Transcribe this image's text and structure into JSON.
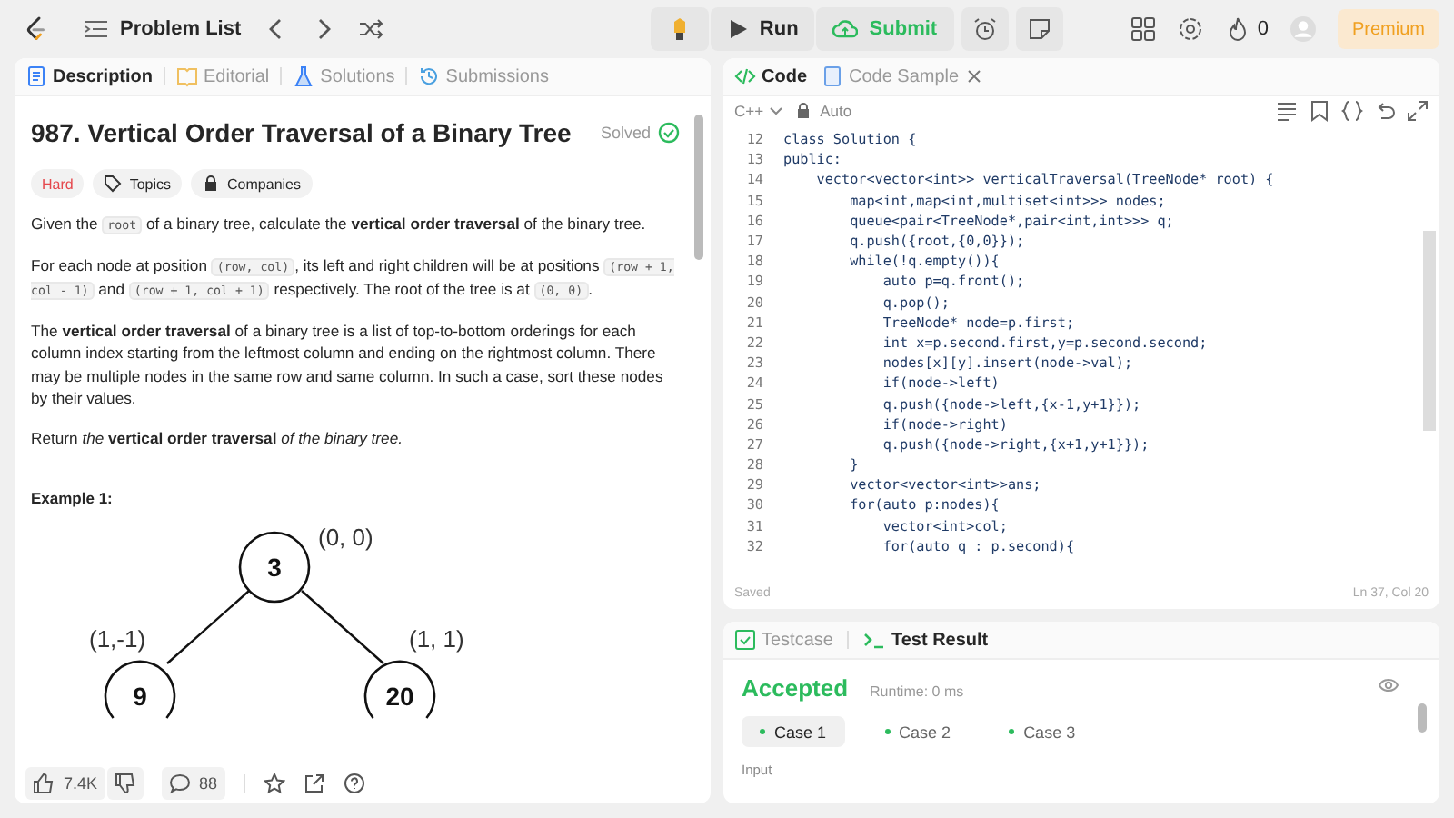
{
  "topbar": {
    "problem_list": "Problem List",
    "run": "Run",
    "submit": "Submit",
    "streak": "0",
    "premium": "Premium"
  },
  "left_tabs": [
    {
      "label": "Description",
      "selected": true
    },
    {
      "label": "Editorial",
      "selected": false
    },
    {
      "label": "Solutions",
      "selected": false
    },
    {
      "label": "Submissions",
      "selected": false
    }
  ],
  "problem": {
    "title": "987. Vertical Order Traversal of a Binary Tree",
    "status": "Solved",
    "difficulty": "Hard",
    "tags": [
      "Topics",
      "Companies"
    ],
    "paragraphs": [
      [
        {
          "kind": "text",
          "text": "Given the "
        },
        {
          "kind": "code",
          "text": "root"
        },
        {
          "kind": "text",
          "text": " of a binary tree, calculate the **vertical order traversal** of the binary tree."
        }
      ],
      [
        {
          "kind": "text",
          "text": "For each node at position "
        },
        {
          "kind": "code",
          "text": "(row, col)"
        },
        {
          "kind": "text",
          "text": ", its left and right children will be at positions "
        },
        {
          "kind": "code",
          "text": "(row + 1, col - 1)"
        },
        {
          "kind": "text",
          "text": " and "
        },
        {
          "kind": "code",
          "text": "(row + 1, col + 1)"
        },
        {
          "kind": "text",
          "text": " respectively. The root of the tree is at "
        },
        {
          "kind": "code",
          "text": "(0, 0)"
        },
        {
          "kind": "text",
          "text": "."
        }
      ],
      [
        {
          "kind": "text",
          "text": "The **vertical order traversal** of a binary tree is a list of top-to-bottom orderings for each column index starting from the leftmost column and ending on the rightmost column. There may be multiple nodes in the same row and same column. In such a case, sort these nodes by their values."
        }
      ],
      [
        {
          "kind": "text",
          "text": "Return *the* **vertical order traversal** *of the binary tree.*"
        }
      ]
    ],
    "example_title": "Example 1:",
    "tree": {
      "root": {
        "value": "3",
        "coord": "(0, 0)"
      },
      "left": {
        "value": "9",
        "coord": "(1,-1)"
      },
      "right": {
        "value": "20",
        "coord": "(1, 1)"
      }
    }
  },
  "footer": {
    "likes": "7.4K",
    "comments": "88"
  },
  "code_tabs": [
    {
      "label": "Code",
      "selected": true
    },
    {
      "label": "Code Sample",
      "selected": false
    }
  ],
  "editor": {
    "language": "C++",
    "mode": "Auto",
    "status": "Saved",
    "cursor": "Ln 37, Col 20",
    "lines": [
      {
        "num": "12",
        "text": "class Solution {"
      },
      {
        "num": "13",
        "text": "public:"
      },
      {
        "num": "14",
        "text": "    vector<vector<int>> verticalTraversal(TreeNode* root) {"
      },
      {
        "num": "15",
        "text": "        map<int,map<int,multiset<int>>> nodes;"
      },
      {
        "num": "16",
        "text": "        queue<pair<TreeNode*,pair<int,int>>> q;"
      },
      {
        "num": "17",
        "text": "        q.push({root,{0,0}});"
      },
      {
        "num": "18",
        "text": "        while(!q.empty()){"
      },
      {
        "num": "19",
        "text": "            auto p=q.front();"
      },
      {
        "num": "20",
        "text": "            q.pop();"
      },
      {
        "num": "21",
        "text": "            TreeNode* node=p.first;"
      },
      {
        "num": "22",
        "text": "            int x=p.second.first,y=p.second.second;"
      },
      {
        "num": "23",
        "text": "            nodes[x][y].insert(node->val);"
      },
      {
        "num": "24",
        "text": "            if(node->left)"
      },
      {
        "num": "25",
        "text": "            q.push({node->left,{x-1,y+1}});"
      },
      {
        "num": "26",
        "text": "            if(node->right)"
      },
      {
        "num": "27",
        "text": "            q.push({node->right,{x+1,y+1}});"
      },
      {
        "num": "28",
        "text": "        }"
      },
      {
        "num": "29",
        "text": "        vector<vector<int>>ans;"
      },
      {
        "num": "30",
        "text": "        for(auto p:nodes){"
      },
      {
        "num": "31",
        "text": "            vector<int>col;"
      },
      {
        "num": "32",
        "text": "            for(auto q : p.second){"
      }
    ]
  },
  "result_tabs": [
    {
      "label": "Testcase",
      "selected": false
    },
    {
      "label": "Test Result",
      "selected": true
    }
  ],
  "result": {
    "verdict": "Accepted",
    "runtime": "Runtime: 0 ms",
    "cases": [
      {
        "label": "Case 1",
        "selected": true
      },
      {
        "label": "Case 2",
        "selected": false
      },
      {
        "label": "Case 3",
        "selected": false
      }
    ],
    "input_label": "Input"
  }
}
